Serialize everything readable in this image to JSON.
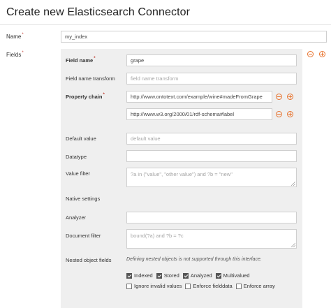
{
  "page": {
    "title": "Create new Elasticsearch Connector"
  },
  "name_field": {
    "label": "Name",
    "value": "my_index"
  },
  "fields": {
    "label": "Fields",
    "field_name": {
      "label": "Field name",
      "value": "grape"
    },
    "field_name_transform": {
      "label": "Field name transform",
      "placeholder": "field name transform"
    },
    "property_chain": {
      "label": "Property chain",
      "values": [
        "http://www.ontotext.com/example/wine#madeFromGrape",
        "http://www.w3.org/2000/01/rdf-schema#label"
      ]
    },
    "default_value": {
      "label": "Default value",
      "placeholder": "default value"
    },
    "datatype": {
      "label": "Datatype",
      "value": ""
    },
    "value_filter": {
      "label": "Value filter",
      "placeholder": "?a in (\"value\", \"other value\") and ?b = \"new\""
    },
    "native_settings": {
      "label": "Native settings"
    },
    "analyzer": {
      "label": "Analyzer",
      "value": ""
    },
    "document_filter": {
      "label": "Document filter",
      "placeholder": "bound(?a) and ?b = ?c"
    },
    "nested_object_fields": {
      "label": "Nested object fields",
      "note": "Defining nested objects is not supported through this interface."
    },
    "options_row1": [
      {
        "label": "Indexed",
        "checked": true
      },
      {
        "label": "Stored",
        "checked": true
      },
      {
        "label": "Analyzed",
        "checked": true
      },
      {
        "label": "Multivalued",
        "checked": true
      }
    ],
    "options_row2": [
      {
        "label": "Ignore invalid values",
        "checked": false
      },
      {
        "label": "Enforce fielddata",
        "checked": false
      },
      {
        "label": "Enforce array",
        "checked": false
      }
    ]
  },
  "colors": {
    "accent": "#e8722c",
    "required": "#c0392b",
    "panel": "#efefef"
  },
  "icons": {
    "remove": "minus-circle-icon",
    "add": "plus-circle-icon"
  }
}
